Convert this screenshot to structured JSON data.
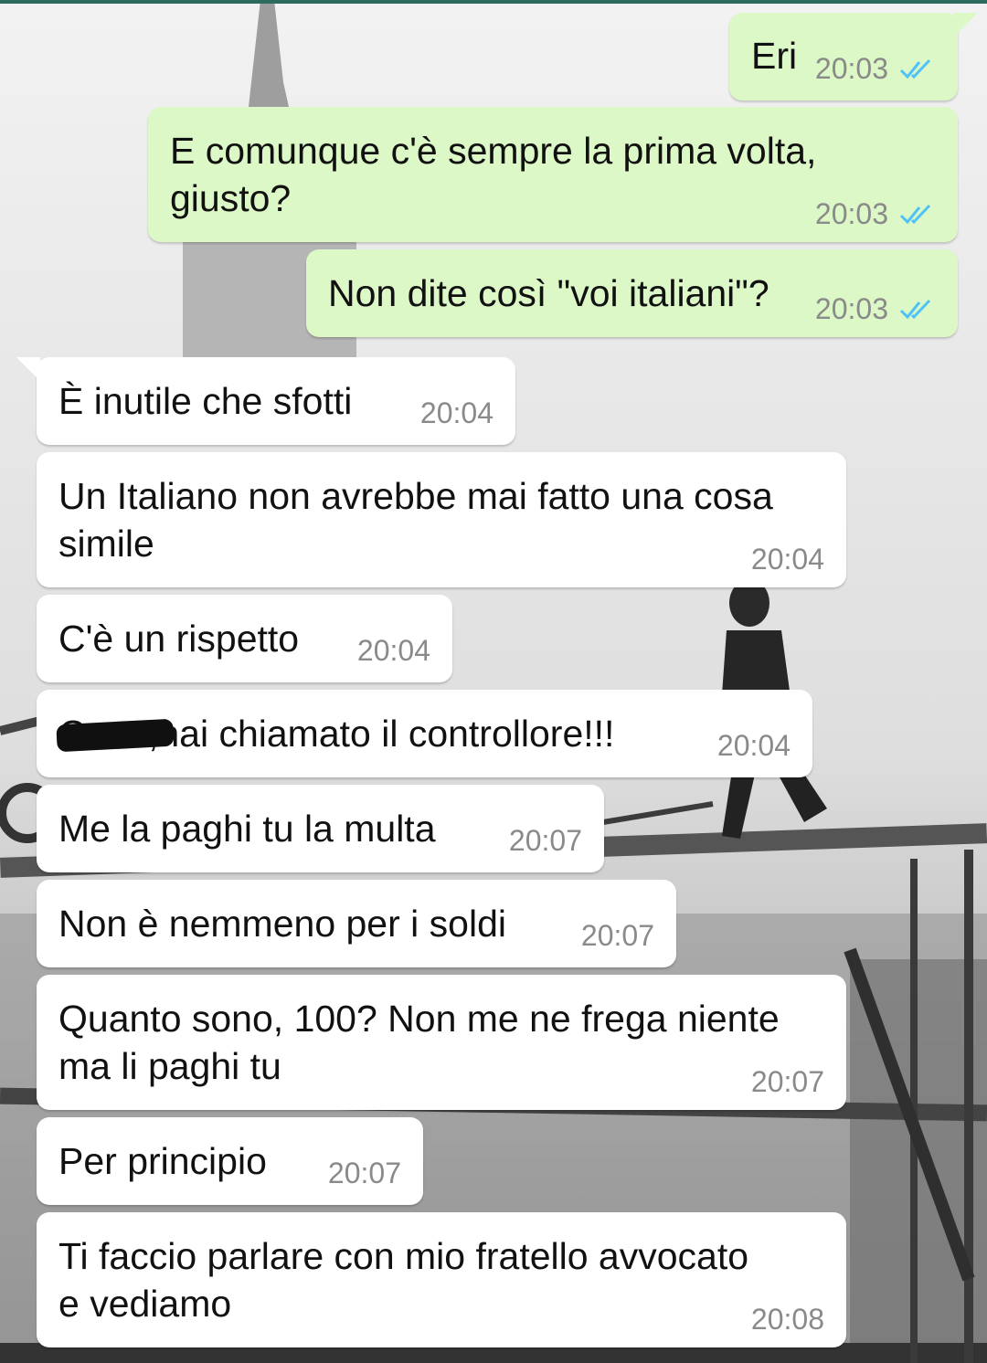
{
  "messages": [
    {
      "text": "Eri",
      "time": "20:03",
      "direction": "out",
      "read": true
    },
    {
      "text": "E comunque c'è sempre la prima volta,\ngiusto?",
      "time": "20:03",
      "direction": "out",
      "read": true
    },
    {
      "text": "Non dite così \"voi italiani\"?",
      "time": "20:03",
      "direction": "out",
      "read": true
    },
    {
      "text": "È inutile che sfotti",
      "time": "20:04",
      "direction": "in"
    },
    {
      "text": "Un Italiano non avrebbe mai fatto una cosa\nsimile",
      "time": "20:04",
      "direction": "in"
    },
    {
      "text": "C'è un rispetto",
      "time": "20:04",
      "direction": "in"
    },
    {
      "text": "C      ,hai chiamato il controllore!!!",
      "time": "20:04",
      "direction": "in",
      "redacted": true
    },
    {
      "text": "Me la paghi tu la multa",
      "time": "20:07",
      "direction": "in"
    },
    {
      "text": "Non è nemmeno per i soldi",
      "time": "20:07",
      "direction": "in"
    },
    {
      "text": "Quanto sono, 100? Non me ne frega niente\nma li paghi tu",
      "time": "20:07",
      "direction": "in"
    },
    {
      "text": "Per principio",
      "time": "20:07",
      "direction": "in"
    },
    {
      "text": "Ti faccio parlare con mio fratello avvocato\ne vediamo",
      "time": "20:08",
      "direction": "in"
    }
  ],
  "icons": {
    "read_receipt": "double-check-icon"
  },
  "colors": {
    "outgoing_bubble": "#dcf8c6",
    "incoming_bubble": "#ffffff",
    "read_ticks": "#4fc3f7",
    "timestamp": "#8a8a8a"
  },
  "wallpaper": "black-and-white photo of a construction worker on a skyscraper girder"
}
